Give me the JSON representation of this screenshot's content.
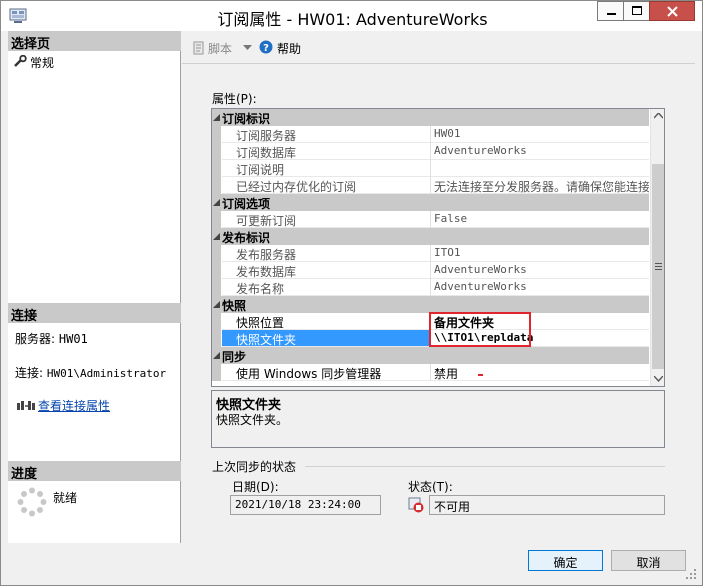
{
  "window": {
    "title": "订阅属性 - HW01: AdventureWorks"
  },
  "left": {
    "select_page": {
      "heading": "选择页",
      "items": [
        {
          "label": "常规"
        }
      ]
    },
    "connection": {
      "heading": "连接",
      "server_label": "服务器:",
      "server_value": "HW01",
      "conn_label": "连接:",
      "conn_value": "HW01\\Administrator",
      "view_link": "查看连接属性"
    },
    "progress": {
      "heading": "进度",
      "status": "就绪"
    }
  },
  "toolbar": {
    "script": "脚本",
    "help": "帮助"
  },
  "properties": {
    "label": "属性(P):",
    "categories": [
      {
        "name": "订阅标识",
        "rows": [
          {
            "name": "订阅服务器",
            "value": "HW01"
          },
          {
            "name": "订阅数据库",
            "value": "AdventureWorks"
          },
          {
            "name": "订阅说明",
            "value": ""
          },
          {
            "name": "已经过内存优化的订阅",
            "value": "无法连接至分发服务器。请确保您能连接"
          }
        ]
      },
      {
        "name": "订阅选项",
        "rows": [
          {
            "name": "可更新订阅",
            "value": "False"
          }
        ]
      },
      {
        "name": "发布标识",
        "rows": [
          {
            "name": "发布服务器",
            "value": "ITO1"
          },
          {
            "name": "发布数据库",
            "value": "AdventureWorks"
          },
          {
            "name": "发布名称",
            "value": "AdventureWorks"
          }
        ]
      },
      {
        "name": "快照",
        "rows": [
          {
            "name": "快照位置",
            "value": "备用文件夹"
          },
          {
            "name": "快照文件夹",
            "value": "\\\\ITO1\\repldata"
          }
        ]
      },
      {
        "name": "同步",
        "rows": [
          {
            "name": "使用 Windows 同步管理器",
            "value": "禁用"
          }
        ]
      }
    ]
  },
  "description": {
    "title": "快照文件夹",
    "text": "快照文件夹。"
  },
  "last_sync": {
    "heading": "上次同步的状态",
    "date_label": "日期(D):",
    "date_value": "2021/10/18 23:24:00",
    "status_label": "状态(T):",
    "status_value": "不可用"
  },
  "buttons": {
    "ok": "确定",
    "cancel": "取消"
  },
  "colors": {
    "selection": "#3399ff",
    "highlight_box": "#e0262c",
    "link": "#0645ad"
  }
}
